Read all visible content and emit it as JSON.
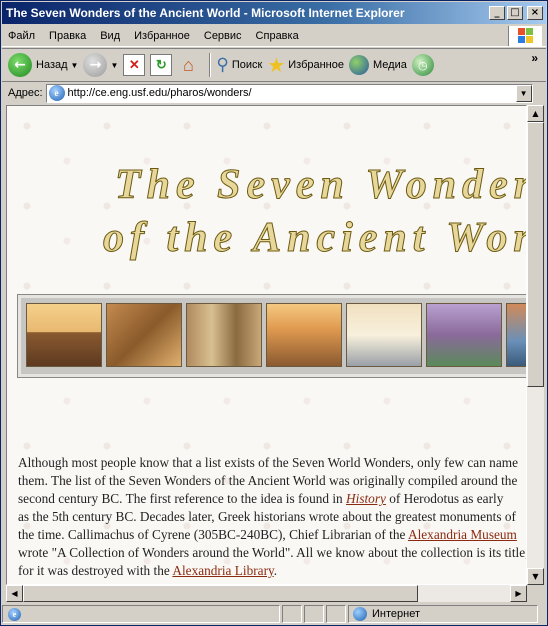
{
  "window": {
    "title": "The Seven Wonders of the Ancient World - Microsoft Internet Explorer",
    "controls": {
      "minimize": "_",
      "maximize": "□",
      "close": "×"
    }
  },
  "menu": [
    "Файл",
    "Правка",
    "Вид",
    "Избранное",
    "Сервис",
    "Справка"
  ],
  "toolbar": {
    "back_label": "Назад",
    "search_label": "Поиск",
    "favorites_label": "Избранное",
    "media_label": "Медиа",
    "more": "»",
    "icons": [
      "back-icon",
      "forward-icon",
      "stop-icon",
      "refresh-icon",
      "home-icon",
      "search-icon",
      "favorites-star-icon",
      "media-icon",
      "history-icon"
    ]
  },
  "address": {
    "label": "Адрес:",
    "url": "http://ce.eng.usf.edu/pharos/wonders/"
  },
  "page": {
    "heading_line1": "The Seven Wonders",
    "heading_line2": "of the Ancient World",
    "wonders_images": [
      "Great Pyramid of Giza",
      "Hanging Gardens of Babylon",
      "Statue of Zeus at Olympia",
      "Temple of Artemis at Ephesus",
      "Mausoleum at Halicarnassus",
      "Colossus of Rhodes",
      "Lighthouse of Alexandria"
    ],
    "para": {
      "l1": "Although most people know that a list exists of the Seven World Wonders, only few can name",
      "l2": "them. The list of the Seven Wonders of the Ancient World was originally compiled around the",
      "l3a": "second century BC. The first reference to the idea is found in ",
      "l3_link": "History",
      "l3b": " of Herodotus as early",
      "l4": "as the 5th century BC. Decades later, Greek historians wrote about the greatest monuments of",
      "l5a": "the time. Callimachus of Cyrene (305BC-240BC), Chief Librarian of the ",
      "l5_link": "Alexandria Museum",
      "l6": "wrote \"A Collection of Wonders around the World\". All we know about the collection is its title,",
      "l7a": "for it was destroyed with the ",
      "l7_link": "Alexandria Library",
      "l7b": "."
    }
  },
  "status": {
    "zone": "Интернет"
  },
  "colors": {
    "titlebar": "#0a246a",
    "link": "#8a2a10",
    "heading_fill": "#e8d79a",
    "heading_outline": "#6b5a10"
  }
}
